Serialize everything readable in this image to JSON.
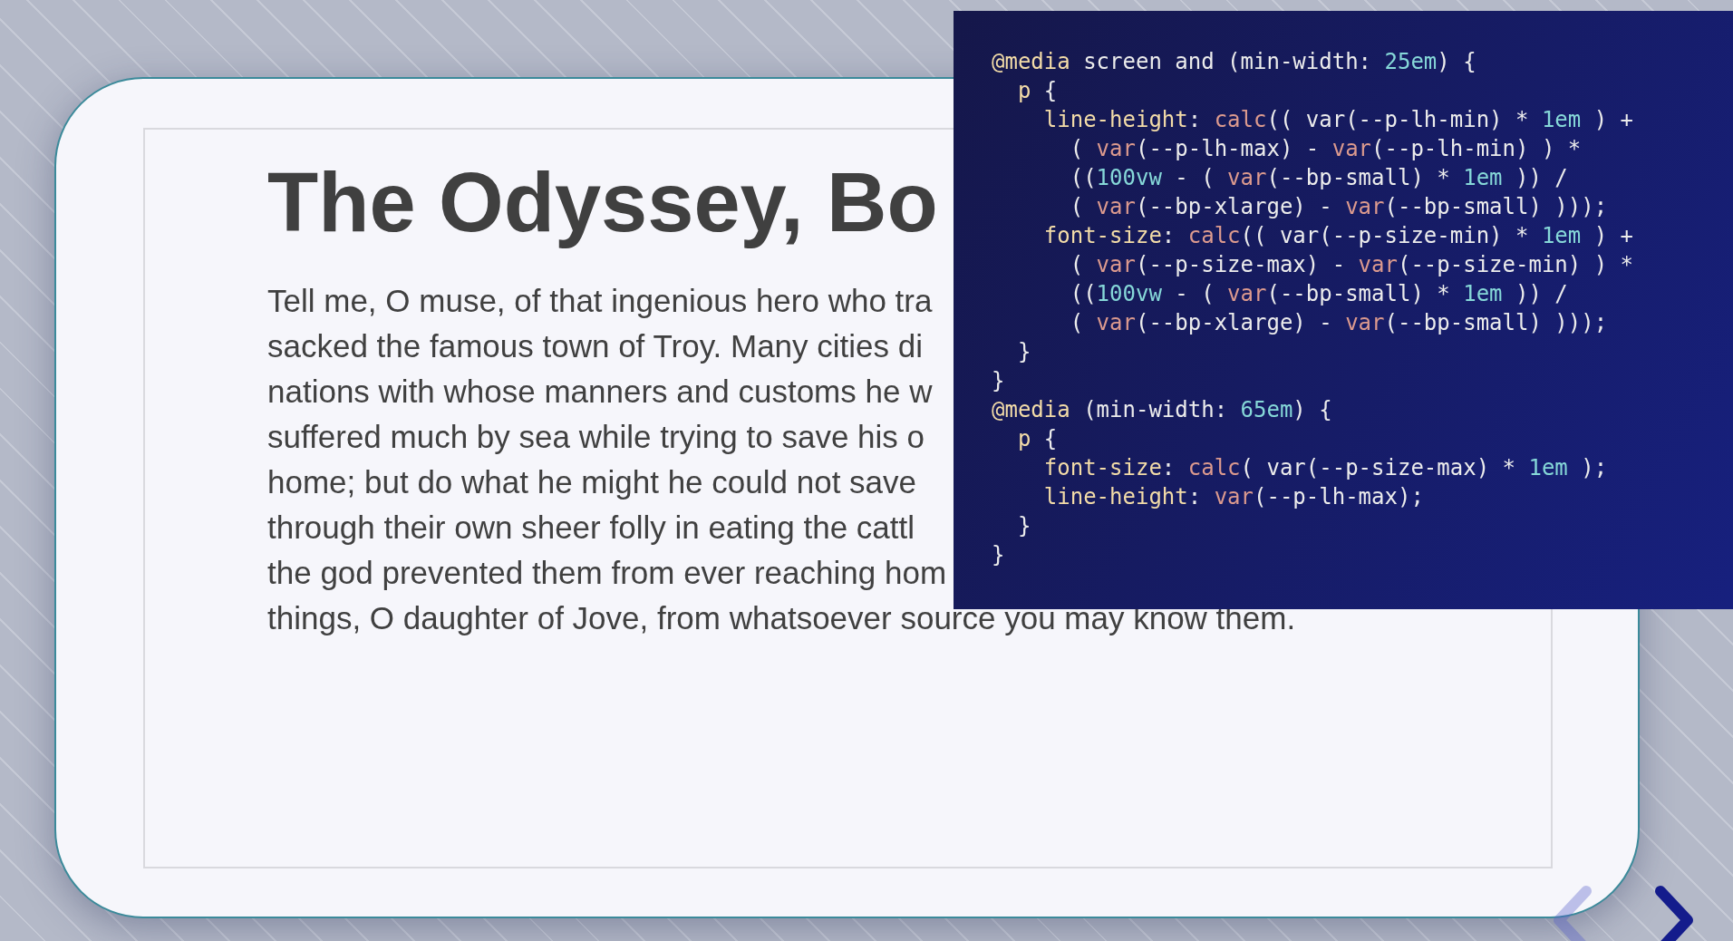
{
  "slide": {
    "title": "The Odyssey, Bo",
    "paragraph_lines": [
      "Tell me, O muse, of that ingenious hero who tra",
      "sacked the famous town of Troy. Many cities di",
      "nations with whose manners and customs he w",
      "suffered much by sea while trying to save his o",
      "home; but do what he might he could not save",
      "through their own sheer folly in eating the cattl",
      "the god prevented them from ever reaching hom",
      "things, O daughter of Jove, from whatsoever source you may know them."
    ]
  },
  "code_overlay": {
    "lines": [
      [
        {
          "text": "@media",
          "kind": "keyword"
        },
        {
          "text": " screen and (min-width: ",
          "kind": "plain"
        },
        {
          "text": "25em",
          "kind": "number"
        },
        {
          "text": ") {",
          "kind": "plain"
        }
      ],
      [
        {
          "text": "  p",
          "kind": "keyword"
        },
        {
          "text": " {",
          "kind": "plain"
        }
      ],
      [
        {
          "text": "    line-height",
          "kind": "keyword"
        },
        {
          "text": ": ",
          "kind": "plain"
        },
        {
          "text": "calc",
          "kind": "function"
        },
        {
          "text": "(( var(--p-lh-min) * ",
          "kind": "plain"
        },
        {
          "text": "1em",
          "kind": "number"
        },
        {
          "text": " ) +",
          "kind": "plain"
        }
      ],
      [
        {
          "text": "      ( ",
          "kind": "plain"
        },
        {
          "text": "var",
          "kind": "function"
        },
        {
          "text": "(--p-lh-max) - ",
          "kind": "plain"
        },
        {
          "text": "var",
          "kind": "function"
        },
        {
          "text": "(--p-lh-min) ) *",
          "kind": "plain"
        }
      ],
      [
        {
          "text": "      ((",
          "kind": "plain"
        },
        {
          "text": "100vw",
          "kind": "number"
        },
        {
          "text": " - ( ",
          "kind": "plain"
        },
        {
          "text": "var",
          "kind": "function"
        },
        {
          "text": "(--bp-small) * ",
          "kind": "plain"
        },
        {
          "text": "1em",
          "kind": "number"
        },
        {
          "text": " )) /",
          "kind": "plain"
        }
      ],
      [
        {
          "text": "      ( ",
          "kind": "plain"
        },
        {
          "text": "var",
          "kind": "function"
        },
        {
          "text": "(--bp-xlarge) - ",
          "kind": "plain"
        },
        {
          "text": "var",
          "kind": "function"
        },
        {
          "text": "(--bp-small) )));",
          "kind": "plain"
        }
      ],
      [
        {
          "text": "    font-size",
          "kind": "keyword"
        },
        {
          "text": ": ",
          "kind": "plain"
        },
        {
          "text": "calc",
          "kind": "function"
        },
        {
          "text": "(( var(--p-size-min) * ",
          "kind": "plain"
        },
        {
          "text": "1em",
          "kind": "number"
        },
        {
          "text": " ) +",
          "kind": "plain"
        }
      ],
      [
        {
          "text": "      ( ",
          "kind": "plain"
        },
        {
          "text": "var",
          "kind": "function"
        },
        {
          "text": "(--p-size-max) - ",
          "kind": "plain"
        },
        {
          "text": "var",
          "kind": "function"
        },
        {
          "text": "(--p-size-min) ) *",
          "kind": "plain"
        }
      ],
      [
        {
          "text": "      ((",
          "kind": "plain"
        },
        {
          "text": "100vw",
          "kind": "number"
        },
        {
          "text": " - ( ",
          "kind": "plain"
        },
        {
          "text": "var",
          "kind": "function"
        },
        {
          "text": "(--bp-small) * ",
          "kind": "plain"
        },
        {
          "text": "1em",
          "kind": "number"
        },
        {
          "text": " )) /",
          "kind": "plain"
        }
      ],
      [
        {
          "text": "      ( ",
          "kind": "plain"
        },
        {
          "text": "var",
          "kind": "function"
        },
        {
          "text": "(--bp-xlarge) - ",
          "kind": "plain"
        },
        {
          "text": "var",
          "kind": "function"
        },
        {
          "text": "(--bp-small) )));",
          "kind": "plain"
        }
      ],
      [
        {
          "text": "  }",
          "kind": "plain"
        }
      ],
      [
        {
          "text": "}",
          "kind": "plain"
        }
      ],
      [
        {
          "text": "@media",
          "kind": "keyword"
        },
        {
          "text": " (min-width: ",
          "kind": "plain"
        },
        {
          "text": "65em",
          "kind": "number"
        },
        {
          "text": ") {",
          "kind": "plain"
        }
      ],
      [
        {
          "text": "  p",
          "kind": "keyword"
        },
        {
          "text": " {",
          "kind": "plain"
        }
      ],
      [
        {
          "text": "    font-size",
          "kind": "keyword"
        },
        {
          "text": ": ",
          "kind": "plain"
        },
        {
          "text": "calc",
          "kind": "function"
        },
        {
          "text": "( var(--p-size-max) * ",
          "kind": "plain"
        },
        {
          "text": "1em",
          "kind": "number"
        },
        {
          "text": " );",
          "kind": "plain"
        }
      ],
      [
        {
          "text": "    line-height",
          "kind": "keyword"
        },
        {
          "text": ": ",
          "kind": "plain"
        },
        {
          "text": "var",
          "kind": "function"
        },
        {
          "text": "(--p-lh-max);",
          "kind": "plain"
        }
      ],
      [
        {
          "text": "  }",
          "kind": "plain"
        }
      ],
      [
        {
          "text": "}",
          "kind": "plain"
        }
      ]
    ]
  },
  "navigation": {
    "previous": {
      "disabled": true
    },
    "next": {
      "disabled": false
    }
  }
}
